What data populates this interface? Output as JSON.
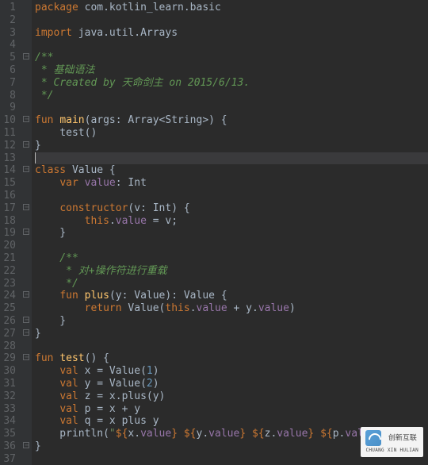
{
  "watermark": {
    "brand": "创新互联",
    "tag": "CHUANG XIN HULIAN"
  },
  "highlighted_line": 13,
  "fold_lines": [
    5,
    10,
    12,
    14,
    17,
    19,
    24,
    26,
    27,
    29,
    36
  ],
  "lines": [
    {
      "n": 1,
      "tokens": [
        {
          "t": "package ",
          "c": "kw"
        },
        {
          "t": "com.kotlin_learn.basic",
          "c": "pkg"
        }
      ]
    },
    {
      "n": 2,
      "tokens": []
    },
    {
      "n": 3,
      "tokens": [
        {
          "t": "import ",
          "c": "kw"
        },
        {
          "t": "java.util.Arrays",
          "c": "pkg"
        }
      ]
    },
    {
      "n": 4,
      "tokens": []
    },
    {
      "n": 5,
      "tokens": [
        {
          "t": "/**",
          "c": "doc"
        }
      ]
    },
    {
      "n": 6,
      "tokens": [
        {
          "t": " * 基础语法",
          "c": "doc"
        }
      ]
    },
    {
      "n": 7,
      "tokens": [
        {
          "t": " * Created by 天命剑主 on 2015/6/13.",
          "c": "doc"
        }
      ]
    },
    {
      "n": 8,
      "tokens": [
        {
          "t": " */",
          "c": "doc"
        }
      ]
    },
    {
      "n": 9,
      "tokens": []
    },
    {
      "n": 10,
      "tokens": [
        {
          "t": "fun ",
          "c": "kw"
        },
        {
          "t": "main",
          "c": "fn"
        },
        {
          "t": "(args: Array<String>) {",
          "c": ""
        }
      ]
    },
    {
      "n": 11,
      "tokens": [
        {
          "t": "    test()",
          "c": ""
        }
      ]
    },
    {
      "n": 12,
      "tokens": [
        {
          "t": "}",
          "c": ""
        }
      ]
    },
    {
      "n": 13,
      "tokens": [],
      "caret": true
    },
    {
      "n": 14,
      "tokens": [
        {
          "t": "class ",
          "c": "kw"
        },
        {
          "t": "Value {",
          "c": ""
        }
      ]
    },
    {
      "n": 15,
      "tokens": [
        {
          "t": "    ",
          "c": ""
        },
        {
          "t": "var ",
          "c": "kw"
        },
        {
          "t": "value",
          "c": "prop"
        },
        {
          "t": ": Int",
          "c": ""
        }
      ]
    },
    {
      "n": 16,
      "tokens": []
    },
    {
      "n": 17,
      "tokens": [
        {
          "t": "    ",
          "c": ""
        },
        {
          "t": "constructor",
          "c": "kw"
        },
        {
          "t": "(v: Int) {",
          "c": ""
        }
      ]
    },
    {
      "n": 18,
      "tokens": [
        {
          "t": "        ",
          "c": ""
        },
        {
          "t": "this",
          "c": "kw"
        },
        {
          "t": ".",
          "c": ""
        },
        {
          "t": "value",
          "c": "prop"
        },
        {
          "t": " = v;",
          "c": ""
        }
      ]
    },
    {
      "n": 19,
      "tokens": [
        {
          "t": "    }",
          "c": ""
        }
      ]
    },
    {
      "n": 20,
      "tokens": []
    },
    {
      "n": 21,
      "tokens": [
        {
          "t": "    /**",
          "c": "doc"
        }
      ]
    },
    {
      "n": 22,
      "tokens": [
        {
          "t": "     * 对+操作符进行重载",
          "c": "doc"
        }
      ]
    },
    {
      "n": 23,
      "tokens": [
        {
          "t": "     */",
          "c": "doc"
        }
      ]
    },
    {
      "n": 24,
      "tokens": [
        {
          "t": "    ",
          "c": ""
        },
        {
          "t": "fun ",
          "c": "kw"
        },
        {
          "t": "plus",
          "c": "fn"
        },
        {
          "t": "(y: Value): Value {",
          "c": ""
        }
      ]
    },
    {
      "n": 25,
      "tokens": [
        {
          "t": "        ",
          "c": ""
        },
        {
          "t": "return ",
          "c": "kw"
        },
        {
          "t": "Value(",
          "c": ""
        },
        {
          "t": "this",
          "c": "kw"
        },
        {
          "t": ".",
          "c": ""
        },
        {
          "t": "value",
          "c": "prop"
        },
        {
          "t": " + y.",
          "c": ""
        },
        {
          "t": "value",
          "c": "prop"
        },
        {
          "t": ")",
          "c": ""
        }
      ]
    },
    {
      "n": 26,
      "tokens": [
        {
          "t": "    }",
          "c": ""
        }
      ]
    },
    {
      "n": 27,
      "tokens": [
        {
          "t": "}",
          "c": ""
        }
      ]
    },
    {
      "n": 28,
      "tokens": []
    },
    {
      "n": 29,
      "tokens": [
        {
          "t": "fun ",
          "c": "kw"
        },
        {
          "t": "test",
          "c": "fn"
        },
        {
          "t": "() {",
          "c": ""
        }
      ]
    },
    {
      "n": 30,
      "tokens": [
        {
          "t": "    ",
          "c": ""
        },
        {
          "t": "val ",
          "c": "kw"
        },
        {
          "t": "x = Value(",
          "c": ""
        },
        {
          "t": "1",
          "c": "num"
        },
        {
          "t": ")",
          "c": ""
        }
      ]
    },
    {
      "n": 31,
      "tokens": [
        {
          "t": "    ",
          "c": ""
        },
        {
          "t": "val ",
          "c": "kw"
        },
        {
          "t": "y = Value(",
          "c": ""
        },
        {
          "t": "2",
          "c": "num"
        },
        {
          "t": ")",
          "c": ""
        }
      ]
    },
    {
      "n": 32,
      "tokens": [
        {
          "t": "    ",
          "c": ""
        },
        {
          "t": "val ",
          "c": "kw"
        },
        {
          "t": "z = x.plus(y)",
          "c": ""
        }
      ]
    },
    {
      "n": 33,
      "tokens": [
        {
          "t": "    ",
          "c": ""
        },
        {
          "t": "val ",
          "c": "kw"
        },
        {
          "t": "p = x + y",
          "c": ""
        }
      ]
    },
    {
      "n": 34,
      "tokens": [
        {
          "t": "    ",
          "c": ""
        },
        {
          "t": "val ",
          "c": "kw"
        },
        {
          "t": "q = x plus y",
          "c": ""
        }
      ]
    },
    {
      "n": 35,
      "tokens": [
        {
          "t": "    println(",
          "c": ""
        },
        {
          "t": "\"",
          "c": "str"
        },
        {
          "t": "${",
          "c": "kw"
        },
        {
          "t": "x.",
          "c": ""
        },
        {
          "t": "value",
          "c": "prop"
        },
        {
          "t": "}",
          "c": "kw"
        },
        {
          "t": " ",
          "c": "str"
        },
        {
          "t": "${",
          "c": "kw"
        },
        {
          "t": "y.",
          "c": ""
        },
        {
          "t": "value",
          "c": "prop"
        },
        {
          "t": "}",
          "c": "kw"
        },
        {
          "t": " ",
          "c": "str"
        },
        {
          "t": "${",
          "c": "kw"
        },
        {
          "t": "z.",
          "c": ""
        },
        {
          "t": "value",
          "c": "prop"
        },
        {
          "t": "}",
          "c": "kw"
        },
        {
          "t": " ",
          "c": "str"
        },
        {
          "t": "${",
          "c": "kw"
        },
        {
          "t": "p.",
          "c": ""
        },
        {
          "t": "value",
          "c": "prop"
        },
        {
          "t": "}",
          "c": "kw"
        }
      ]
    },
    {
      "n": 36,
      "tokens": [
        {
          "t": "}",
          "c": ""
        }
      ]
    },
    {
      "n": 37,
      "tokens": []
    }
  ]
}
